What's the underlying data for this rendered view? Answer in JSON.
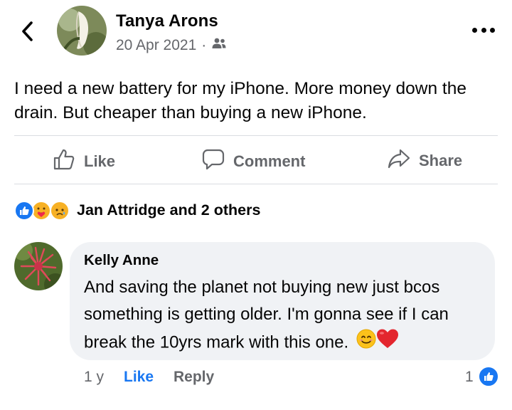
{
  "post": {
    "author": "Tanya Arons",
    "date": "20 Apr 2021",
    "separator": "·",
    "audience_icon": "friends-icon",
    "text": "I need a new battery for my iPhone.  More money down the drain.  But cheaper than buying a new iPhone."
  },
  "actions": {
    "like": "Like",
    "comment": "Comment",
    "share": "Share"
  },
  "reactions": {
    "icons": [
      "like-reaction-icon",
      "care-reaction-icon",
      "sad-reaction-icon"
    ],
    "summary": "Jan Attridge and 2 others"
  },
  "comment": {
    "author": "Kelly Anne",
    "text": "And saving the planet not buying new just bcos something is getting older. I'm gonna see if I can break the 10yrs mark with this one.",
    "emojis": [
      "smiling-face-emoji",
      "red-heart-emoji"
    ],
    "time": "1 y",
    "like_label": "Like",
    "reply_label": "Reply",
    "reaction_count": "1",
    "reaction_icon": "like-reaction-icon"
  },
  "colors": {
    "accent": "#1877f2",
    "secondary_text": "#65676b",
    "bubble": "#f0f2f5"
  }
}
